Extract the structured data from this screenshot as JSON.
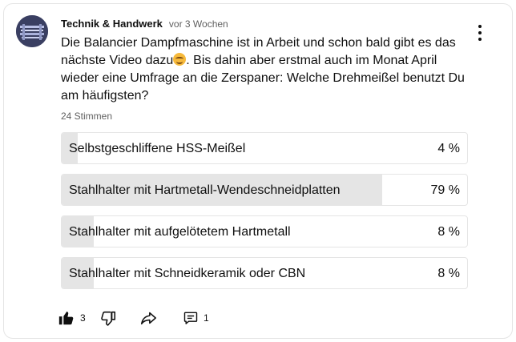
{
  "post": {
    "author": "Technik & Handwerk",
    "time": "vor 3 Wochen",
    "text_part1": "Die Balancier Dampfmaschine ist in Arbeit und schon bald gibt es das nächste Video dazu",
    "emoji_icon": "smiling-face-emoji",
    "text_part2": ". Bis dahin aber erstmal auch im Monat April wieder eine Umfrage an die Zerspaner: Welche Drehmeißel benutzt Du am häufigsten?",
    "votes": "24 Stimmen"
  },
  "poll": {
    "options": [
      {
        "label": "Selbstgeschliffene HSS-Meißel",
        "percent_text": "4 %",
        "percent": 4
      },
      {
        "label": "Stahlhalter mit Hartmetall-Wendeschneidplatten",
        "percent_text": "79 %",
        "percent": 79
      },
      {
        "label": "Stahlhalter mit aufgelötetem Hartmetall",
        "percent_text": "8 %",
        "percent": 8
      },
      {
        "label": "Stahlhalter mit Schneidkeramik oder CBN",
        "percent_text": "8 %",
        "percent": 8
      }
    ]
  },
  "actions": {
    "like_count": "3",
    "comment_count": "1",
    "like_icon": "thumbs-up-icon",
    "dislike_icon": "thumbs-down-icon",
    "share_icon": "share-icon",
    "comment_icon": "comment-icon",
    "menu_icon": "more-vert-icon"
  },
  "colors": {
    "bar_fill": "#e5e5e5",
    "border": "#e5e5e5",
    "secondary_text": "#606060",
    "avatar_bg": "#3a3f62"
  }
}
